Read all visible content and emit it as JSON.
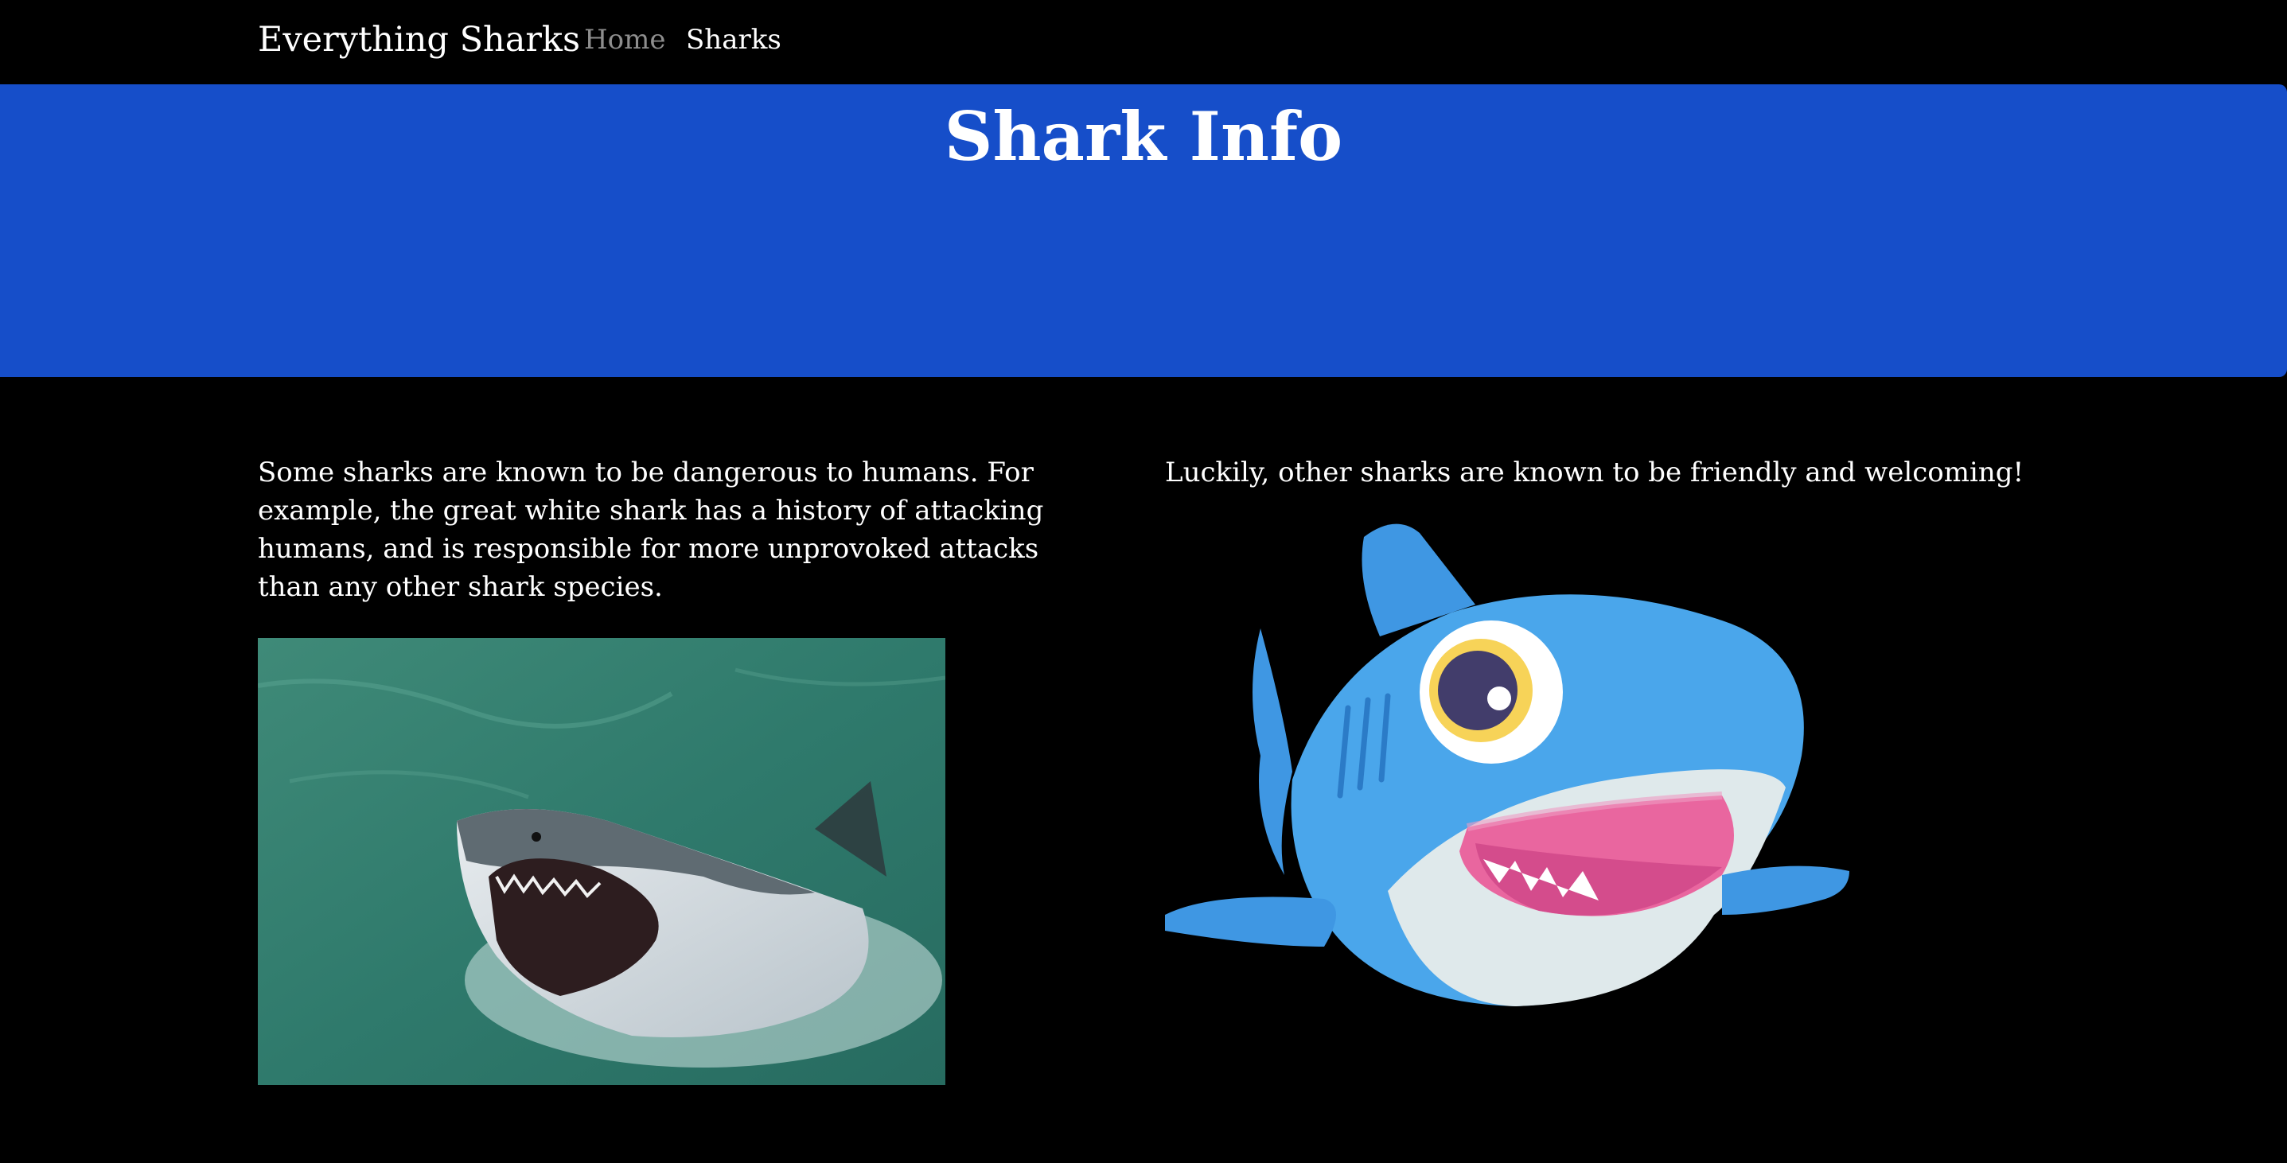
{
  "navbar": {
    "brand": "Everything Sharks",
    "links": [
      {
        "label": "Home"
      },
      {
        "label": "Sharks"
      }
    ]
  },
  "jumbotron": {
    "title": "Shark Info"
  },
  "left_column": {
    "text": "Some sharks are known to be dangerous to humans. For example, the great white shark has a history of attacking humans, and is responsible for more unprovoked attacks than any other shark species.",
    "image_icon": "great-white-shark-photo"
  },
  "right_column": {
    "text": "Luckily, other sharks are known to be friendly and welcoming!",
    "image_icon": "cartoon-shark-illustration"
  },
  "colors": {
    "background": "#000000",
    "jumbotron": "#164ec9",
    "nav_inactive": "#8e8e8e",
    "text": "#ffffff"
  }
}
